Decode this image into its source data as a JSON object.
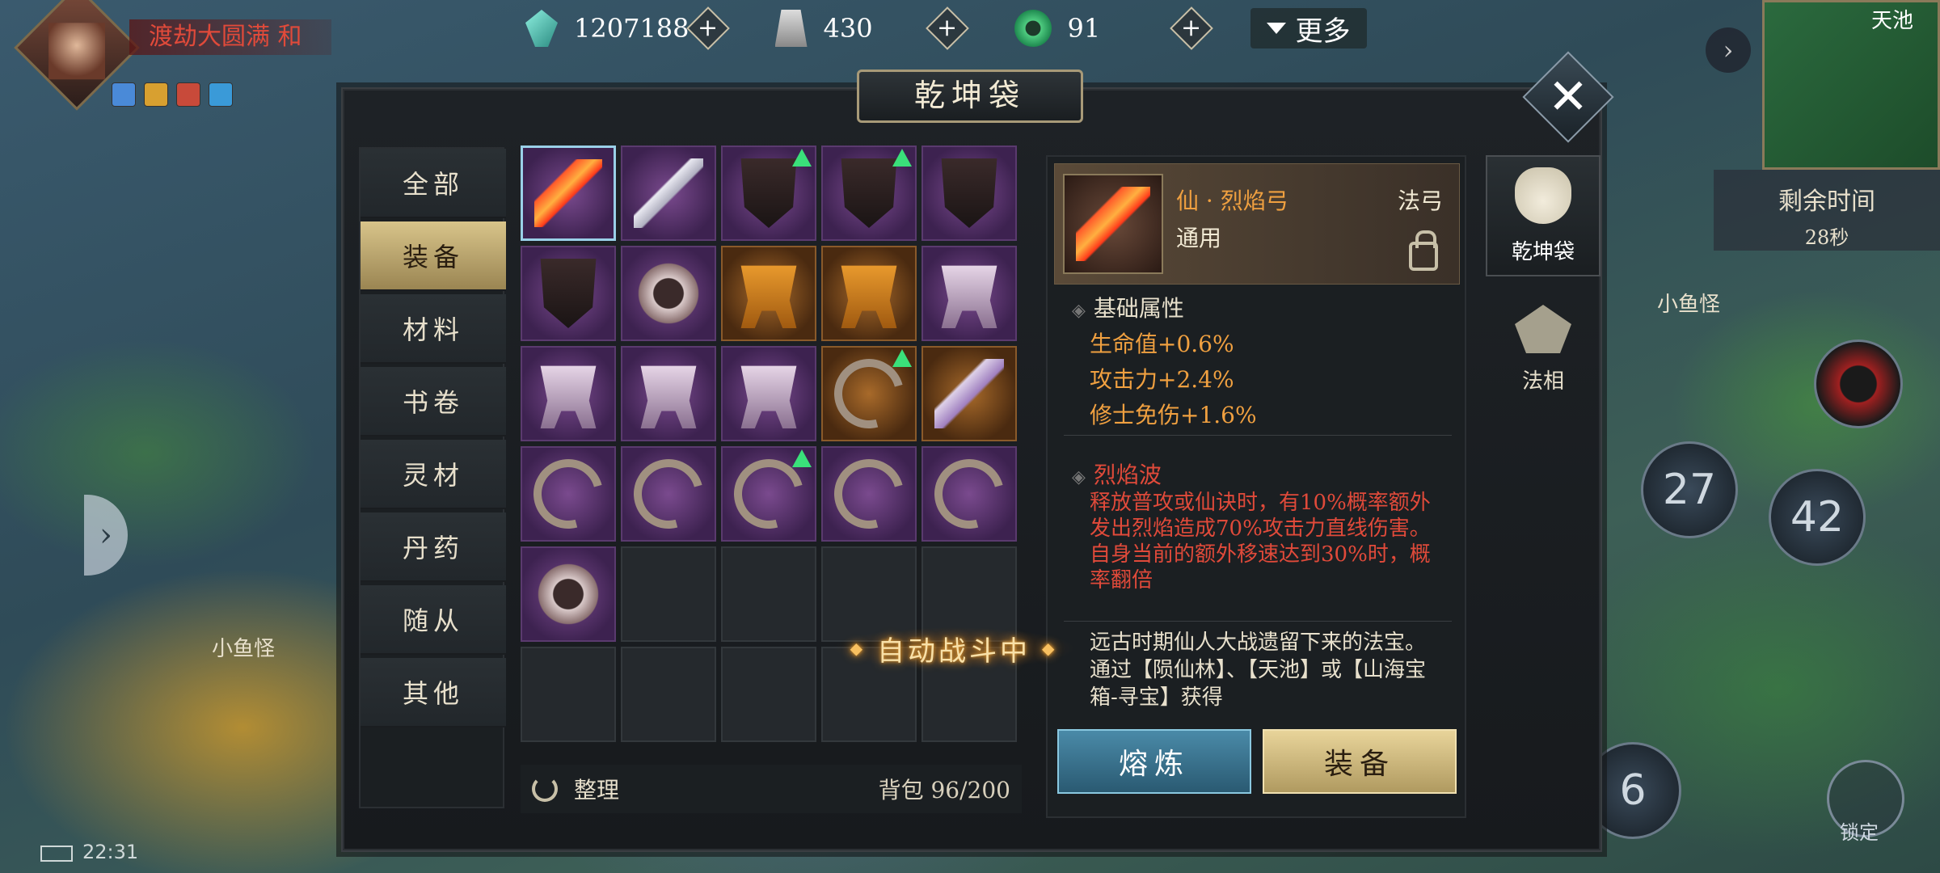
{
  "player": {
    "title": "渡劫大圆满",
    "title_suffix": "和",
    "buffs": [
      "#4a8ad8",
      "#d8a030",
      "#c84a3a",
      "#3a9ad8"
    ]
  },
  "currency": {
    "spirit_stone": "1207188",
    "token": "430",
    "jade": "91",
    "more_label": "更多"
  },
  "minimap": {
    "title": "天池"
  },
  "timer": {
    "label": "剩余时间",
    "value": "28秒"
  },
  "dialog": {
    "title": "乾坤袋",
    "close_symbol": "✕",
    "tabs": [
      "全部",
      "装备",
      "材料",
      "书卷",
      "灵材",
      "丹药",
      "随从",
      "其他"
    ],
    "active_tab": "装备",
    "sort_label": "整理",
    "bag_count": "背包 96/200",
    "side_tabs": [
      "乾坤袋",
      "法相"
    ],
    "inventory": [
      {
        "art": "bow",
        "rarity": "purple",
        "selected": true,
        "upgrade": false
      },
      {
        "art": "sword",
        "rarity": "purple",
        "selected": false,
        "upgrade": false
      },
      {
        "art": "banner",
        "rarity": "purple",
        "selected": false,
        "upgrade": true
      },
      {
        "art": "banner",
        "rarity": "purple",
        "selected": false,
        "upgrade": true
      },
      {
        "art": "banner",
        "rarity": "purple",
        "selected": false,
        "upgrade": false
      },
      {
        "art": "banner",
        "rarity": "purple",
        "selected": false,
        "upgrade": false
      },
      {
        "art": "shield",
        "rarity": "purple",
        "selected": false,
        "upgrade": false
      },
      {
        "art": "cauldron",
        "rarity": "orange",
        "selected": false,
        "upgrade": false
      },
      {
        "art": "cauldron",
        "rarity": "orange",
        "selected": false,
        "upgrade": false
      },
      {
        "art": "cauldron-silver",
        "rarity": "purple",
        "selected": false,
        "upgrade": false
      },
      {
        "art": "cauldron-silver",
        "rarity": "purple",
        "selected": false,
        "upgrade": false
      },
      {
        "art": "cauldron-silver",
        "rarity": "purple",
        "selected": false,
        "upgrade": false
      },
      {
        "art": "cauldron-silver",
        "rarity": "purple",
        "selected": false,
        "upgrade": false
      },
      {
        "art": "claw",
        "rarity": "orange",
        "selected": false,
        "upgrade": true
      },
      {
        "art": "feather",
        "rarity": "orange",
        "selected": false,
        "upgrade": false
      },
      {
        "art": "claw",
        "rarity": "purple",
        "selected": false,
        "upgrade": false
      },
      {
        "art": "claw",
        "rarity": "purple",
        "selected": false,
        "upgrade": false
      },
      {
        "art": "claw",
        "rarity": "purple",
        "selected": false,
        "upgrade": true
      },
      {
        "art": "claw",
        "rarity": "purple",
        "selected": false,
        "upgrade": false
      },
      {
        "art": "claw",
        "rarity": "purple",
        "selected": false,
        "upgrade": false
      },
      {
        "art": "shield",
        "rarity": "purple",
        "selected": false,
        "upgrade": false
      },
      {
        "art": "",
        "rarity": "empty"
      },
      {
        "art": "",
        "rarity": "empty"
      },
      {
        "art": "",
        "rarity": "empty"
      },
      {
        "art": "",
        "rarity": "empty"
      },
      {
        "art": "",
        "rarity": "empty"
      },
      {
        "art": "",
        "rarity": "empty"
      },
      {
        "art": "",
        "rarity": "empty"
      },
      {
        "art": "",
        "rarity": "empty"
      },
      {
        "art": "",
        "rarity": "empty"
      }
    ]
  },
  "item": {
    "name": "仙 · 烈焰弓",
    "type": "法弓",
    "usage": "通用",
    "base_attr_title": "基础属性",
    "stats": [
      "生命值+0.6%",
      "攻击力+2.4%",
      "修士免伤+1.6%"
    ],
    "skill_name": "烈焰波",
    "skill_desc": "释放普攻或仙诀时，有10%概率额外发出烈焰造成70%攻击力直线伤害。自身当前的额外移速达到30%时，概率翻倍",
    "lore": "远古时期仙人大战遗留下来的法宝。通过【陨仙林】、【天池】或【山海宝箱-寻宝】获得",
    "smelt_label": "熔炼",
    "equip_label": "装备"
  },
  "hud": {
    "auto_battle": "自动战斗中",
    "clock": "22:31",
    "monster_left": "小鱼怪",
    "monster_right": "小鱼怪",
    "skill_cd_1": "27",
    "skill_cd_2": "42",
    "skill_cd_3": "6",
    "lock_label": "锁定"
  },
  "colors": {
    "accent_gold": "#d8c48a",
    "rarity_purple": "#7a4a8e",
    "rarity_orange": "#a86a2a",
    "stat_orange": "#f0a040",
    "skill_red": "#e04a3a",
    "upgrade_green": "#3ae07a"
  }
}
